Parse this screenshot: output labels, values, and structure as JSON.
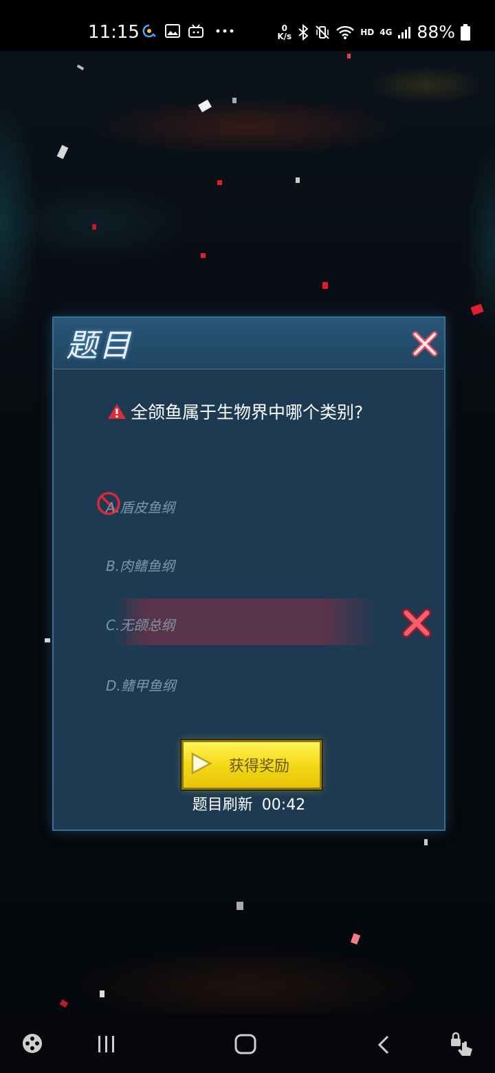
{
  "status_bar": {
    "time": "11:15",
    "net_speed_value": "0",
    "net_speed_unit": "K/s",
    "network_type": "4G",
    "hd_label": "HD",
    "battery": "88%"
  },
  "dialog": {
    "title": "题目",
    "question": "全颌鱼属于生物界中哪个类别?",
    "options": [
      {
        "label": "A.盾皮鱼纲",
        "state": "eliminated"
      },
      {
        "label": "B.肉鳍鱼纲",
        "state": "normal"
      },
      {
        "label": "C.无颌总纲",
        "state": "wrong"
      },
      {
        "label": "D.鳍甲鱼纲",
        "state": "normal"
      }
    ],
    "reward_button": "获得奖励",
    "refresh_label": "题目刷新",
    "refresh_timer": "00:42"
  },
  "colors": {
    "dialog_bg": "#1d3a52",
    "wrong_highlight": "#6e3248",
    "reward_yellow": "#f3d915",
    "alert_red": "#e04050"
  },
  "icons": [
    "warning-icon",
    "close-icon",
    "no-entry-icon",
    "wrong-x-icon",
    "play-icon",
    "game-launcher-icon",
    "recent-apps-icon",
    "home-icon",
    "back-icon",
    "touch-lock-icon"
  ]
}
